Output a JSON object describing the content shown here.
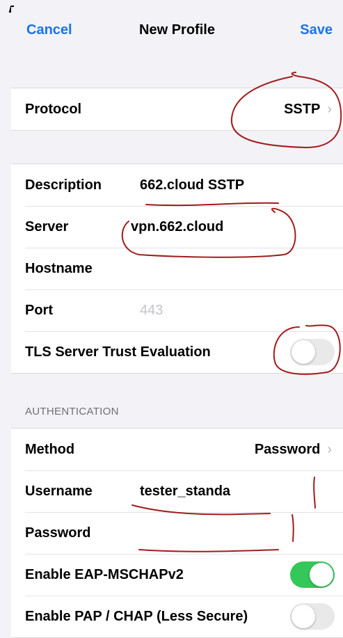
{
  "nav": {
    "cancel_label": "Cancel",
    "title": "New Profile",
    "save_label": "Save"
  },
  "protocol": {
    "label": "Protocol",
    "value": "SSTP"
  },
  "connection": {
    "description": {
      "label": "Description",
      "value": "662.cloud SSTP"
    },
    "server": {
      "label": "Server",
      "value": "vpn.662.cloud"
    },
    "hostname": {
      "label": "Hostname",
      "value": ""
    },
    "port": {
      "label": "Port",
      "placeholder": "443"
    },
    "tls": {
      "label": "TLS Server Trust Evaluation",
      "enabled": false
    }
  },
  "authentication": {
    "header": "AUTHENTICATION",
    "method": {
      "label": "Method",
      "value": "Password"
    },
    "username": {
      "label": "Username",
      "value": "tester_standa"
    },
    "password": {
      "label": "Password",
      "value": ""
    },
    "eap": {
      "label": "Enable EAP-MSCHAPv2",
      "enabled": true
    },
    "pap": {
      "label": "Enable PAP / CHAP (Less Secure)",
      "enabled": false
    }
  },
  "colors": {
    "accent": "#1a73e8",
    "toggle_on": "#34c759",
    "annotation": "#a01c1c"
  }
}
